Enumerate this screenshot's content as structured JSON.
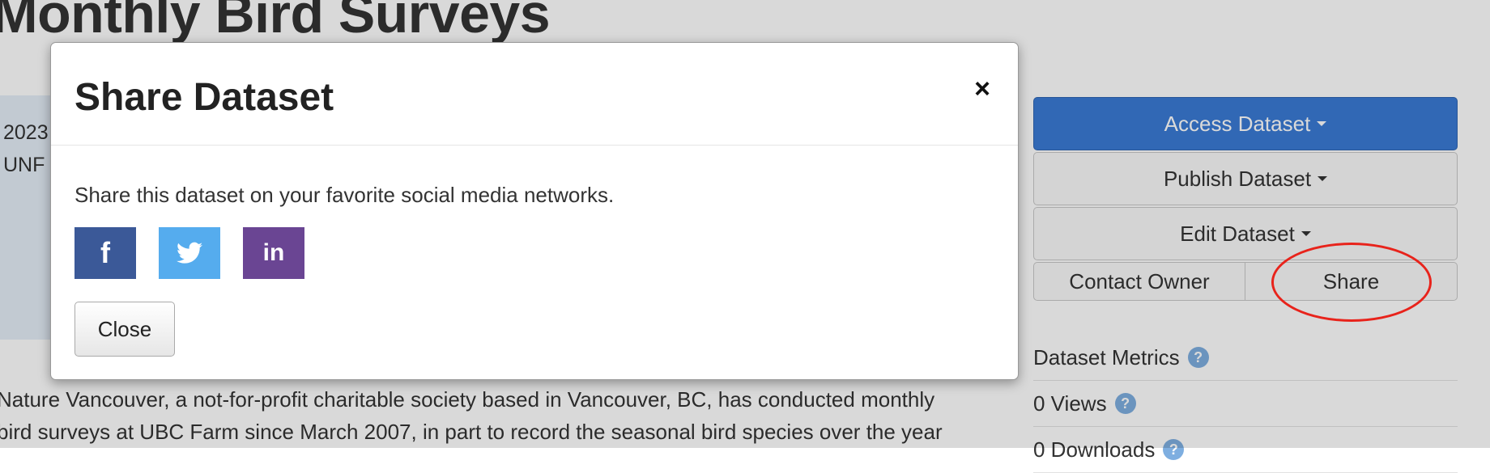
{
  "background": {
    "page_title": "Monthly Bird Surveys",
    "info_panel": {
      "line1": "2023",
      "line2": "UNF"
    },
    "description_lines": [
      "Nature Vancouver, a not-for-profit charitable society based in Vancouver, BC, has conducted monthly",
      "bird surveys at UBC Farm since March 2007, in part to record the seasonal bird species over the year"
    ],
    "actions": {
      "access_label": "Access Dataset",
      "publish_label": "Publish Dataset",
      "edit_label": "Edit Dataset",
      "contact_label": "Contact Owner",
      "share_label": "Share"
    },
    "metrics": {
      "heading": "Dataset Metrics",
      "views": "0 Views",
      "downloads": "0 Downloads",
      "help_glyph": "?"
    }
  },
  "modal": {
    "title": "Share Dataset",
    "close_glyph": "×",
    "body_text": "Share this dataset on your favorite social media networks.",
    "social": [
      {
        "name": "facebook",
        "glyph": "f",
        "color": "#3b5998"
      },
      {
        "name": "twitter",
        "icon": "twitter-bird-icon",
        "color": "#55acee"
      },
      {
        "name": "linkedin",
        "glyph": "in",
        "color": "#6a4593"
      }
    ],
    "close_label": "Close"
  },
  "colors": {
    "primary_button": "#3a7bd5",
    "annotation": "#e8231b",
    "help_icon": "#7eaee0"
  }
}
